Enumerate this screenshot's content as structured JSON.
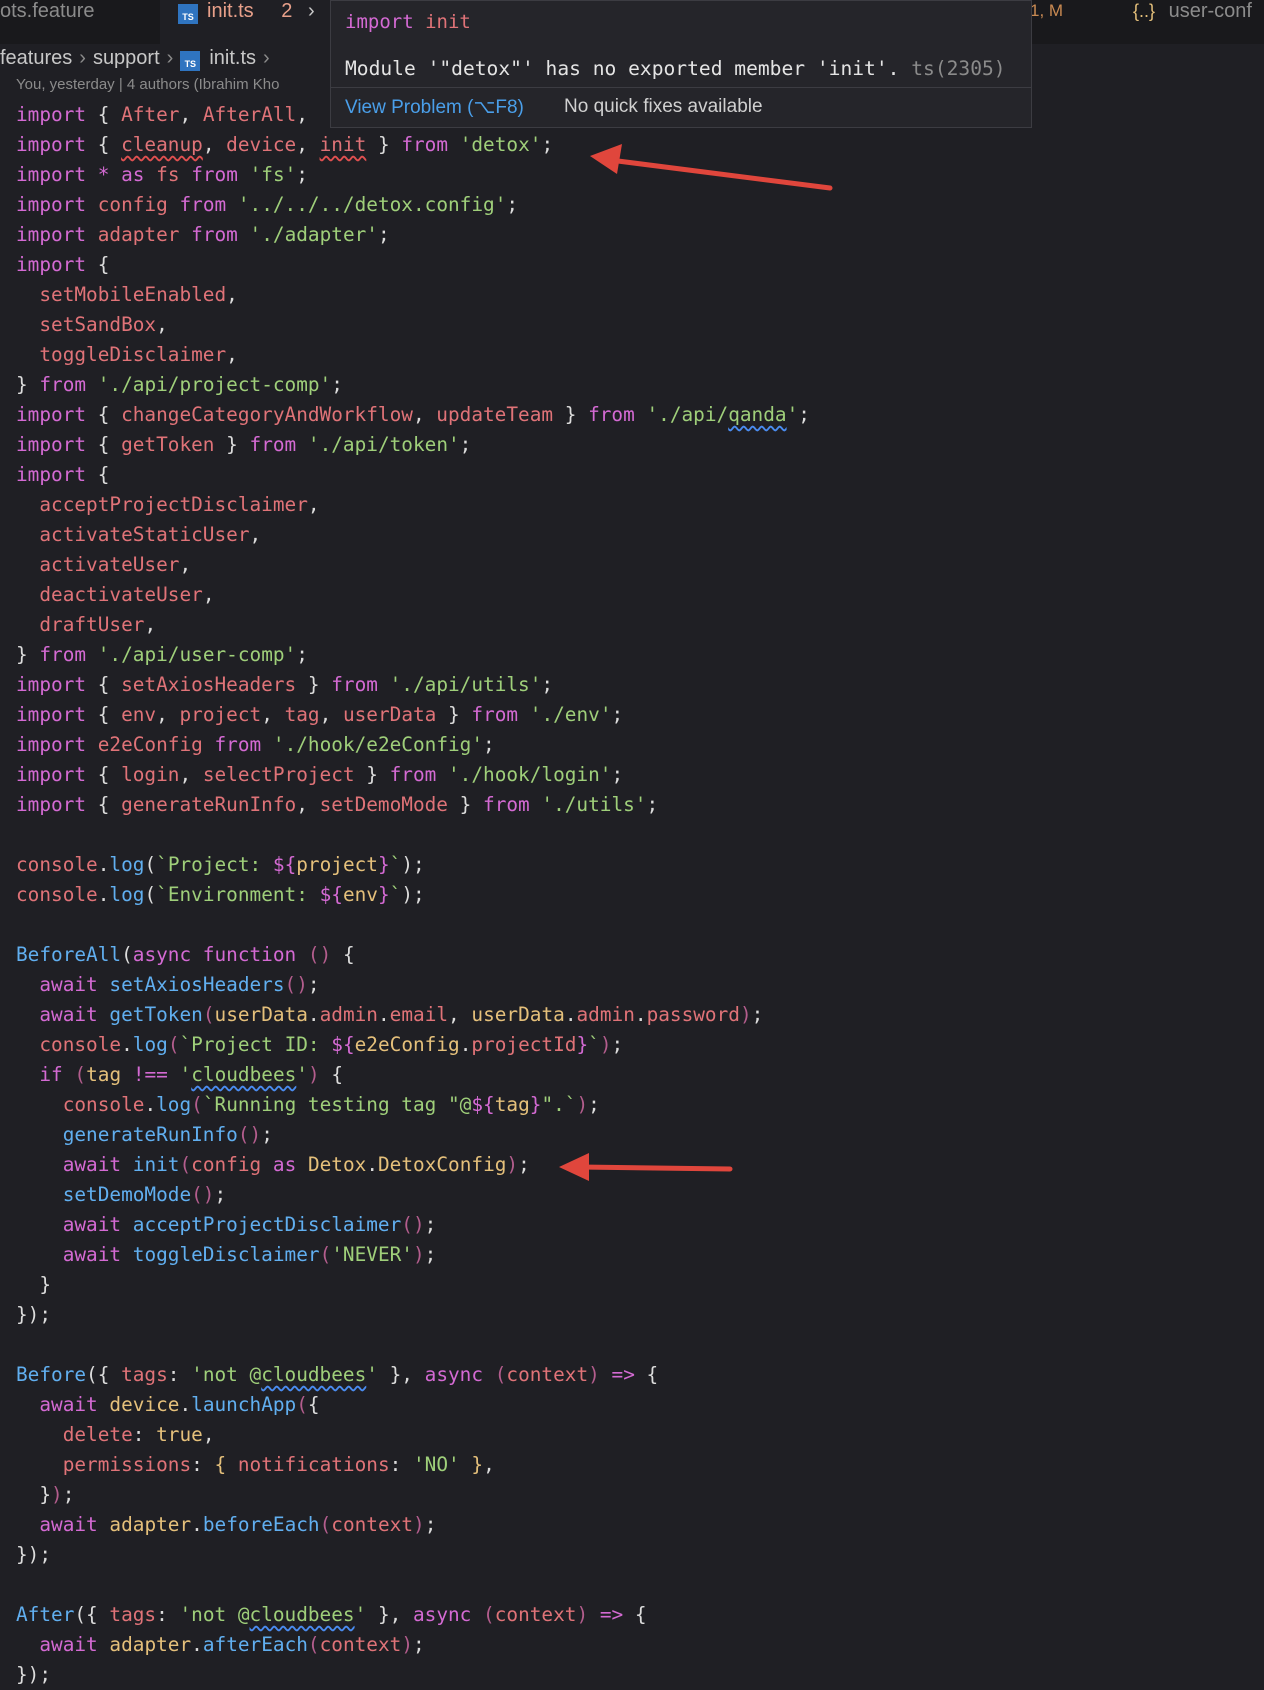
{
  "tabs": [
    {
      "label": "ots.feature"
    },
    {
      "label": "init.ts",
      "problems": "2",
      "badge": "TS"
    },
    {
      "label": "1, M"
    },
    {
      "icon_glyph": "{..}",
      "label": "user-conf"
    }
  ],
  "breadcrumb": [
    "features",
    "support",
    "init.ts"
  ],
  "blame": "You, yesterday | 4 authors (Ibrahim Kho",
  "hover": {
    "signature_kw": "import",
    "signature_name": "init",
    "message": "Module '\"detox\"' has no exported member 'init'.",
    "code": "ts(2305)",
    "view_problem": "View Problem (⌥F8)",
    "no_fixes": "No quick fixes available"
  },
  "colors": {
    "keyword": "#d46ad3",
    "function": "#61aff0",
    "variable": "#e07378",
    "string": "#9fcf7a",
    "class": "#e5c07b",
    "arrow": "#e0463c",
    "link": "#4a9fea"
  },
  "code_lines": [
    [
      [
        "kw",
        "import"
      ],
      [
        "pn",
        " { "
      ],
      [
        "vr",
        "After"
      ],
      [
        "pn",
        ", "
      ],
      [
        "vr",
        "AfterAll"
      ],
      [
        "pn",
        ","
      ]
    ],
    [
      [
        "kw",
        "import"
      ],
      [
        "pn",
        " { "
      ],
      [
        "vr",
        "cleanup",
        "r"
      ],
      [
        "pn",
        ", "
      ],
      [
        "vr",
        "device"
      ],
      [
        "pn",
        ", "
      ],
      [
        "vr",
        "init",
        "r"
      ],
      [
        "pn",
        " } "
      ],
      [
        "kw",
        "from"
      ],
      [
        "pn",
        " "
      ],
      [
        "st",
        "'detox'"
      ],
      [
        "pn",
        ";"
      ]
    ],
    [
      [
        "kw",
        "import"
      ],
      [
        "pn",
        " "
      ],
      [
        "kw",
        "*"
      ],
      [
        "pn",
        " "
      ],
      [
        "kw",
        "as"
      ],
      [
        "pn",
        " "
      ],
      [
        "vr",
        "fs"
      ],
      [
        "pn",
        " "
      ],
      [
        "kw",
        "from"
      ],
      [
        "pn",
        " "
      ],
      [
        "st",
        "'fs'"
      ],
      [
        "pn",
        ";"
      ]
    ],
    [
      [
        "kw",
        "import"
      ],
      [
        "pn",
        " "
      ],
      [
        "vr",
        "config"
      ],
      [
        "pn",
        " "
      ],
      [
        "kw",
        "from"
      ],
      [
        "pn",
        " "
      ],
      [
        "st",
        "'../../../detox.config'"
      ],
      [
        "pn",
        ";"
      ]
    ],
    [
      [
        "kw",
        "import"
      ],
      [
        "pn",
        " "
      ],
      [
        "vr",
        "adapter"
      ],
      [
        "pn",
        " "
      ],
      [
        "kw",
        "from"
      ],
      [
        "pn",
        " "
      ],
      [
        "st",
        "'./adapter'"
      ],
      [
        "pn",
        ";"
      ]
    ],
    [
      [
        "kw",
        "import"
      ],
      [
        "pn",
        " {"
      ]
    ],
    [
      [
        "pn",
        "  "
      ],
      [
        "vr",
        "setMobileEnabled"
      ],
      [
        "pn",
        ","
      ]
    ],
    [
      [
        "pn",
        "  "
      ],
      [
        "vr",
        "setSandBox"
      ],
      [
        "pn",
        ","
      ]
    ],
    [
      [
        "pn",
        "  "
      ],
      [
        "vr",
        "toggleDisclaimer"
      ],
      [
        "pn",
        ","
      ]
    ],
    [
      [
        "pn",
        "} "
      ],
      [
        "kw",
        "from"
      ],
      [
        "pn",
        " "
      ],
      [
        "st",
        "'./api/project-comp'"
      ],
      [
        "pn",
        ";"
      ]
    ],
    [
      [
        "kw",
        "import"
      ],
      [
        "pn",
        " { "
      ],
      [
        "vr",
        "changeCategoryAndWorkflow"
      ],
      [
        "pn",
        ", "
      ],
      [
        "vr",
        "updateTeam"
      ],
      [
        "pn",
        " } "
      ],
      [
        "kw",
        "from"
      ],
      [
        "pn",
        " "
      ],
      [
        "st",
        "'./api/"
      ],
      [
        "st",
        "qanda",
        "b"
      ],
      [
        "st",
        "'"
      ],
      [
        "pn",
        ";"
      ]
    ],
    [
      [
        "kw",
        "import"
      ],
      [
        "pn",
        " { "
      ],
      [
        "vr",
        "getToken"
      ],
      [
        "pn",
        " } "
      ],
      [
        "kw",
        "from"
      ],
      [
        "pn",
        " "
      ],
      [
        "st",
        "'./api/token'"
      ],
      [
        "pn",
        ";"
      ]
    ],
    [
      [
        "kw",
        "import"
      ],
      [
        "pn",
        " {"
      ]
    ],
    [
      [
        "pn",
        "  "
      ],
      [
        "vr",
        "acceptProjectDisclaimer"
      ],
      [
        "pn",
        ","
      ]
    ],
    [
      [
        "pn",
        "  "
      ],
      [
        "vr",
        "activateStaticUser"
      ],
      [
        "pn",
        ","
      ]
    ],
    [
      [
        "pn",
        "  "
      ],
      [
        "vr",
        "activateUser"
      ],
      [
        "pn",
        ","
      ]
    ],
    [
      [
        "pn",
        "  "
      ],
      [
        "vr",
        "deactivateUser"
      ],
      [
        "pn",
        ","
      ]
    ],
    [
      [
        "pn",
        "  "
      ],
      [
        "vr",
        "draftUser"
      ],
      [
        "pn",
        ","
      ]
    ],
    [
      [
        "pn",
        "} "
      ],
      [
        "kw",
        "from"
      ],
      [
        "pn",
        " "
      ],
      [
        "st",
        "'./api/user-comp'"
      ],
      [
        "pn",
        ";"
      ]
    ],
    [
      [
        "kw",
        "import"
      ],
      [
        "pn",
        " { "
      ],
      [
        "vr",
        "setAxiosHeaders"
      ],
      [
        "pn",
        " } "
      ],
      [
        "kw",
        "from"
      ],
      [
        "pn",
        " "
      ],
      [
        "st",
        "'./api/utils'"
      ],
      [
        "pn",
        ";"
      ]
    ],
    [
      [
        "kw",
        "import"
      ],
      [
        "pn",
        " { "
      ],
      [
        "vr",
        "env"
      ],
      [
        "pn",
        ", "
      ],
      [
        "vr",
        "project"
      ],
      [
        "pn",
        ", "
      ],
      [
        "vr",
        "tag"
      ],
      [
        "pn",
        ", "
      ],
      [
        "vr",
        "userData"
      ],
      [
        "pn",
        " } "
      ],
      [
        "kw",
        "from"
      ],
      [
        "pn",
        " "
      ],
      [
        "st",
        "'./env'"
      ],
      [
        "pn",
        ";"
      ]
    ],
    [
      [
        "kw",
        "import"
      ],
      [
        "pn",
        " "
      ],
      [
        "vr",
        "e2eConfig"
      ],
      [
        "pn",
        " "
      ],
      [
        "kw",
        "from"
      ],
      [
        "pn",
        " "
      ],
      [
        "st",
        "'./hook/e2eConfig'"
      ],
      [
        "pn",
        ";"
      ]
    ],
    [
      [
        "kw",
        "import"
      ],
      [
        "pn",
        " { "
      ],
      [
        "vr",
        "login"
      ],
      [
        "pn",
        ", "
      ],
      [
        "vr",
        "selectProject"
      ],
      [
        "pn",
        " } "
      ],
      [
        "kw",
        "from"
      ],
      [
        "pn",
        " "
      ],
      [
        "st",
        "'./hook/login'"
      ],
      [
        "pn",
        ";"
      ]
    ],
    [
      [
        "kw",
        "import"
      ],
      [
        "pn",
        " { "
      ],
      [
        "vr",
        "generateRunInfo"
      ],
      [
        "pn",
        ", "
      ],
      [
        "vr",
        "setDemoMode"
      ],
      [
        "pn",
        " } "
      ],
      [
        "kw",
        "from"
      ],
      [
        "pn",
        " "
      ],
      [
        "st",
        "'./utils'"
      ],
      [
        "pn",
        ";"
      ]
    ],
    [],
    [
      [
        "vr",
        "console"
      ],
      [
        "pn",
        "."
      ],
      [
        "fn",
        "log"
      ],
      [
        "pn",
        "("
      ],
      [
        "st",
        "`Project: "
      ],
      [
        "kw",
        "${"
      ],
      [
        "cl",
        "project"
      ],
      [
        "kw",
        "}"
      ],
      [
        "st",
        "`"
      ],
      [
        "pn",
        ");"
      ]
    ],
    [
      [
        "vr",
        "console"
      ],
      [
        "pn",
        "."
      ],
      [
        "fn",
        "log"
      ],
      [
        "pn",
        "("
      ],
      [
        "st",
        "`Environment: "
      ],
      [
        "kw",
        "${"
      ],
      [
        "cl",
        "env"
      ],
      [
        "kw",
        "}"
      ],
      [
        "st",
        "`"
      ],
      [
        "pn",
        ");"
      ]
    ],
    [],
    [
      [
        "fn",
        "BeforeAll"
      ],
      [
        "pn",
        "("
      ],
      [
        "kw",
        "async function"
      ],
      [
        "pn",
        " "
      ],
      [
        "p2",
        "()"
      ],
      [
        "pn",
        " {"
      ]
    ],
    [
      [
        "pn",
        "  "
      ],
      [
        "kw",
        "await"
      ],
      [
        "pn",
        " "
      ],
      [
        "fn",
        "setAxiosHeaders"
      ],
      [
        "p2",
        "()"
      ],
      [
        "pn",
        ";"
      ]
    ],
    [
      [
        "pn",
        "  "
      ],
      [
        "kw",
        "await"
      ],
      [
        "pn",
        " "
      ],
      [
        "fn",
        "getToken"
      ],
      [
        "p2",
        "("
      ],
      [
        "cl",
        "userData"
      ],
      [
        "pn",
        "."
      ],
      [
        "vr",
        "admin"
      ],
      [
        "pn",
        "."
      ],
      [
        "vr",
        "email"
      ],
      [
        "pn",
        ", "
      ],
      [
        "cl",
        "userData"
      ],
      [
        "pn",
        "."
      ],
      [
        "vr",
        "admin"
      ],
      [
        "pn",
        "."
      ],
      [
        "vr",
        "password"
      ],
      [
        "p2",
        ")"
      ],
      [
        "pn",
        ";"
      ]
    ],
    [
      [
        "pn",
        "  "
      ],
      [
        "vr",
        "console"
      ],
      [
        "pn",
        "."
      ],
      [
        "fn",
        "log"
      ],
      [
        "p2",
        "("
      ],
      [
        "st",
        "`Project ID: "
      ],
      [
        "kw",
        "${"
      ],
      [
        "cl",
        "e2eConfig"
      ],
      [
        "pn",
        "."
      ],
      [
        "vr",
        "projectId"
      ],
      [
        "kw",
        "}"
      ],
      [
        "st",
        "`"
      ],
      [
        "p2",
        ")"
      ],
      [
        "pn",
        ";"
      ]
    ],
    [
      [
        "pn",
        "  "
      ],
      [
        "kw",
        "if"
      ],
      [
        "pn",
        " "
      ],
      [
        "p2",
        "("
      ],
      [
        "cl",
        "tag"
      ],
      [
        "pn",
        " "
      ],
      [
        "kw",
        "!=="
      ],
      [
        "pn",
        " "
      ],
      [
        "st",
        "'"
      ],
      [
        "st",
        "cloudbees",
        "b"
      ],
      [
        "st",
        "'"
      ],
      [
        "p2",
        ")"
      ],
      [
        "pn",
        " {"
      ]
    ],
    [
      [
        "pn",
        "    "
      ],
      [
        "vr",
        "console"
      ],
      [
        "pn",
        "."
      ],
      [
        "fn",
        "log"
      ],
      [
        "p2",
        "("
      ],
      [
        "st",
        "`Running testing tag \"@"
      ],
      [
        "kw",
        "${"
      ],
      [
        "cl",
        "tag"
      ],
      [
        "kw",
        "}"
      ],
      [
        "st",
        "\".`"
      ],
      [
        "p2",
        ")"
      ],
      [
        "pn",
        ";"
      ]
    ],
    [
      [
        "pn",
        "    "
      ],
      [
        "fn",
        "generateRunInfo"
      ],
      [
        "p2",
        "()"
      ],
      [
        "pn",
        ";"
      ]
    ],
    [
      [
        "pn",
        "    "
      ],
      [
        "kw",
        "await"
      ],
      [
        "pn",
        " "
      ],
      [
        "fn",
        "init"
      ],
      [
        "p2",
        "("
      ],
      [
        "vr",
        "config"
      ],
      [
        "pn",
        " "
      ],
      [
        "kw",
        "as"
      ],
      [
        "pn",
        " "
      ],
      [
        "cl",
        "Detox"
      ],
      [
        "pn",
        "."
      ],
      [
        "cl",
        "DetoxConfig"
      ],
      [
        "p2",
        ")"
      ],
      [
        "pn",
        ";"
      ]
    ],
    [
      [
        "pn",
        "    "
      ],
      [
        "fn",
        "setDemoMode"
      ],
      [
        "p2",
        "()"
      ],
      [
        "pn",
        ";"
      ]
    ],
    [
      [
        "pn",
        "    "
      ],
      [
        "kw",
        "await"
      ],
      [
        "pn",
        " "
      ],
      [
        "fn",
        "acceptProjectDisclaimer"
      ],
      [
        "p2",
        "()"
      ],
      [
        "pn",
        ";"
      ]
    ],
    [
      [
        "pn",
        "    "
      ],
      [
        "kw",
        "await"
      ],
      [
        "pn",
        " "
      ],
      [
        "fn",
        "toggleDisclaimer"
      ],
      [
        "p2",
        "("
      ],
      [
        "st",
        "'NEVER'"
      ],
      [
        "p2",
        ")"
      ],
      [
        "pn",
        ";"
      ]
    ],
    [
      [
        "pn",
        "  }"
      ]
    ],
    [
      [
        "pn",
        "});"
      ]
    ],
    [],
    [
      [
        "fn",
        "Before"
      ],
      [
        "pn",
        "({ "
      ],
      [
        "vr",
        "tags"
      ],
      [
        "pn",
        ": "
      ],
      [
        "st",
        "'not @"
      ],
      [
        "st",
        "cloudbees",
        "b"
      ],
      [
        "st",
        "'"
      ],
      [
        "pn",
        " }, "
      ],
      [
        "kw",
        "async"
      ],
      [
        "pn",
        " "
      ],
      [
        "p2",
        "("
      ],
      [
        "vr",
        "context"
      ],
      [
        "p2",
        ")"
      ],
      [
        "pn",
        " "
      ],
      [
        "kw",
        "=>"
      ],
      [
        "pn",
        " {"
      ]
    ],
    [
      [
        "pn",
        "  "
      ],
      [
        "kw",
        "await"
      ],
      [
        "pn",
        " "
      ],
      [
        "cl",
        "device"
      ],
      [
        "pn",
        "."
      ],
      [
        "fn",
        "launchApp"
      ],
      [
        "p2",
        "("
      ],
      [
        "pn",
        "{"
      ]
    ],
    [
      [
        "pn",
        "    "
      ],
      [
        "vr",
        "delete"
      ],
      [
        "pn",
        ": "
      ],
      [
        "cl",
        "true"
      ],
      [
        "pn",
        ","
      ]
    ],
    [
      [
        "pn",
        "    "
      ],
      [
        "vr",
        "permissions"
      ],
      [
        "pn",
        ": "
      ],
      [
        "cl",
        "{"
      ],
      [
        "pn",
        " "
      ],
      [
        "vr",
        "notifications"
      ],
      [
        "pn",
        ": "
      ],
      [
        "st",
        "'NO'"
      ],
      [
        "pn",
        " "
      ],
      [
        "cl",
        "}"
      ],
      [
        "pn",
        ","
      ]
    ],
    [
      [
        "pn",
        "  }"
      ],
      [
        "p2",
        ")"
      ],
      [
        "pn",
        ";"
      ]
    ],
    [
      [
        "pn",
        "  "
      ],
      [
        "kw",
        "await"
      ],
      [
        "pn",
        " "
      ],
      [
        "cl",
        "adapter"
      ],
      [
        "pn",
        "."
      ],
      [
        "fn",
        "beforeEach"
      ],
      [
        "p2",
        "("
      ],
      [
        "vr",
        "context"
      ],
      [
        "p2",
        ")"
      ],
      [
        "pn",
        ";"
      ]
    ],
    [
      [
        "pn",
        "});"
      ]
    ],
    [],
    [
      [
        "fn",
        "After"
      ],
      [
        "pn",
        "({ "
      ],
      [
        "vr",
        "tags"
      ],
      [
        "pn",
        ": "
      ],
      [
        "st",
        "'not @"
      ],
      [
        "st",
        "cloudbees",
        "b"
      ],
      [
        "st",
        "'"
      ],
      [
        "pn",
        " }, "
      ],
      [
        "kw",
        "async"
      ],
      [
        "pn",
        " "
      ],
      [
        "p2",
        "("
      ],
      [
        "vr",
        "context"
      ],
      [
        "p2",
        ")"
      ],
      [
        "pn",
        " "
      ],
      [
        "kw",
        "=>"
      ],
      [
        "pn",
        " {"
      ]
    ],
    [
      [
        "pn",
        "  "
      ],
      [
        "kw",
        "await"
      ],
      [
        "pn",
        " "
      ],
      [
        "cl",
        "adapter"
      ],
      [
        "pn",
        "."
      ],
      [
        "fn",
        "afterEach"
      ],
      [
        "p2",
        "("
      ],
      [
        "vr",
        "context"
      ],
      [
        "p2",
        ")"
      ],
      [
        "pn",
        ";"
      ]
    ],
    [
      [
        "pn",
        "});"
      ]
    ]
  ]
}
